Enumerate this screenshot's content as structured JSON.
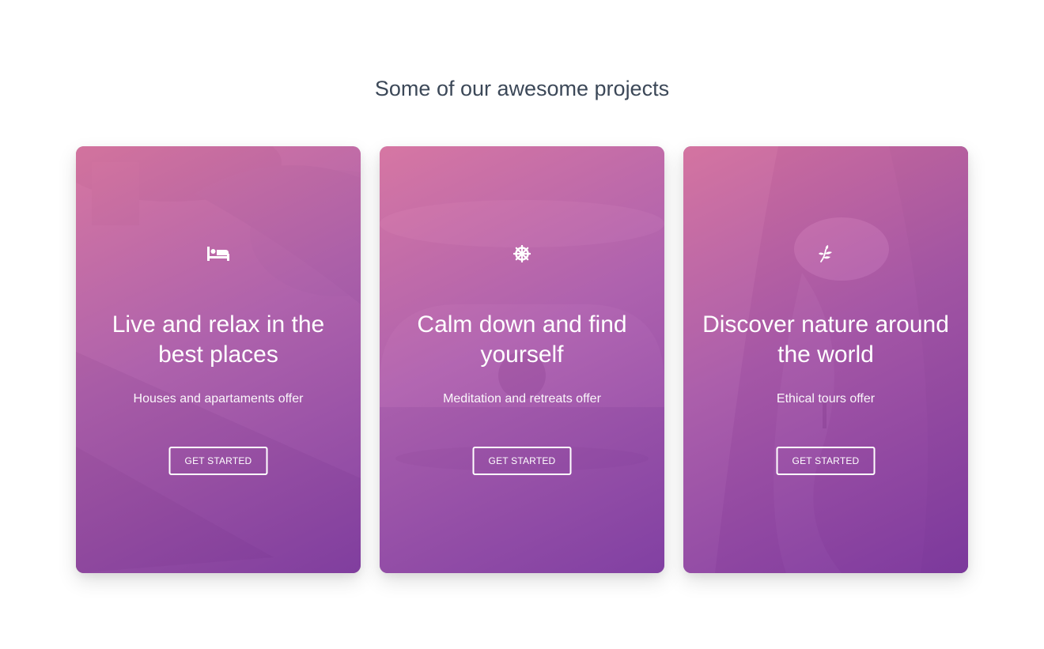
{
  "section": {
    "title": "Some of our awesome projects"
  },
  "cards": [
    {
      "icon": "bed-icon",
      "title": "Live and relax in the best places",
      "description": "Houses and apartaments offer",
      "button_label": "GET STARTED"
    },
    {
      "icon": "dharma-wheel-icon",
      "title": "Calm down and find yourself",
      "description": "Meditation and retreats offer",
      "button_label": "GET STARTED"
    },
    {
      "icon": "leaf-icon",
      "title": "Discover nature around the world",
      "description": "Ethical tours offer",
      "button_label": "GET STARTED"
    }
  ],
  "colors": {
    "title_text": "#3c4858",
    "gradient_start": "#d8709e",
    "gradient_end": "#7d37a0",
    "card_text": "#ffffff"
  }
}
